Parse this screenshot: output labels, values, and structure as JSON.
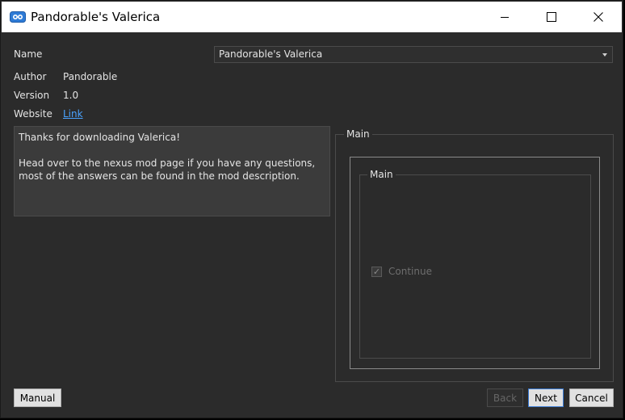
{
  "window": {
    "title": "Pandorable's Valerica",
    "icon": "nexus-mod-manager-icon",
    "controls": [
      "minimize-icon",
      "maximize-icon",
      "close-icon"
    ]
  },
  "info": {
    "name_label": "Name",
    "name_value": "Pandorable's Valerica",
    "author_label": "Author",
    "author_value": "Pandorable",
    "version_label": "Version",
    "version_value": "1.0",
    "website_label": "Website",
    "website_link": "Link"
  },
  "description": {
    "text": "Thanks for downloading Valerica!\n\nHead over to the nexus mod page if you have any questions, most of the answers can be found in the mod description."
  },
  "step": {
    "outer_group_title": "Main",
    "inner_group_title": "Main",
    "option_label": "Continue",
    "option_checked": true,
    "option_enabled": false
  },
  "buttons": {
    "manual": "Manual",
    "back": "Back",
    "next": "Next",
    "cancel": "Cancel"
  },
  "colors": {
    "background": "#2b2b2b",
    "titlebar": "#ffffff",
    "link": "#4aa3ff"
  }
}
